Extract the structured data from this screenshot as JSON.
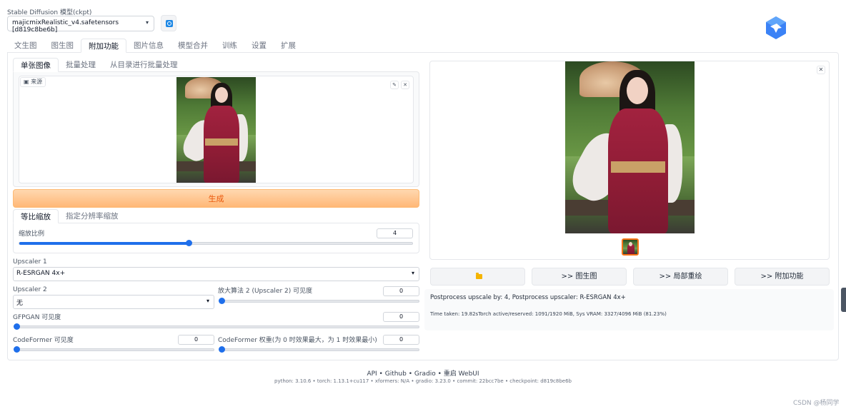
{
  "model": {
    "label": "Stable Diffusion 模型(ckpt)",
    "selected": "majicmixRealistic_v4.safetensors [d819c8be6b]"
  },
  "main_tabs": [
    "文生图",
    "图生图",
    "附加功能",
    "图片信息",
    "模型合并",
    "训练",
    "设置",
    "扩展"
  ],
  "active_main_tab": "附加功能",
  "sub_tabs": [
    "单张图像",
    "批量处理",
    "从目录进行批量处理"
  ],
  "source_label": "来源",
  "generate_label": "生成",
  "scale_tabs": [
    "等比缩放",
    "指定分辨率缩放"
  ],
  "resize": {
    "label": "缩放比例",
    "value": "4",
    "fraction": 0.4
  },
  "upscaler1": {
    "label": "Upscaler 1",
    "value": "R-ESRGAN 4x+"
  },
  "upscaler2": {
    "label": "Upscaler 2",
    "value": "无"
  },
  "upscaler2_visibility": {
    "label": "放大算法 2 (Upscaler 2) 可见度",
    "value": "0"
  },
  "gfpgan": {
    "label": "GFPGAN 可见度",
    "value": "0"
  },
  "codeformer": {
    "label": "CodeFormer 可见度",
    "value": "0"
  },
  "codeformer_weight": {
    "label": "CodeFormer 权重(为 0 时效果最大，为 1 时效果最小)",
    "value": "0"
  },
  "actions": {
    "to_img2img": ">> 图生图",
    "to_inpaint": ">> 局部重绘",
    "to_extras": ">> 附加功能"
  },
  "output_info": "Postprocess upscale by: 4, Postprocess upscaler: R-ESRGAN 4x+",
  "time_info": "Time taken: 19.82sTorch active/reserved: 1091/1920 MiB, Sys VRAM: 3327/4096 MiB (81.23%)",
  "footer": {
    "links": "API • Github • Gradio • 重启 WebUI",
    "versions": "python: 3.10.6  •  torch: 1.13.1+cu117  •  xformers: N/A  •  gradio: 3.23.0  •  commit: 22bcc7be  •  checkpoint: d819c8be6b"
  },
  "watermark": "CSDN @杨同学",
  "colors": {
    "accent": "#1f6feb",
    "generate_bg": "#ffb877",
    "generate_text": "#ea580c",
    "thumb_border": "#f97316"
  }
}
